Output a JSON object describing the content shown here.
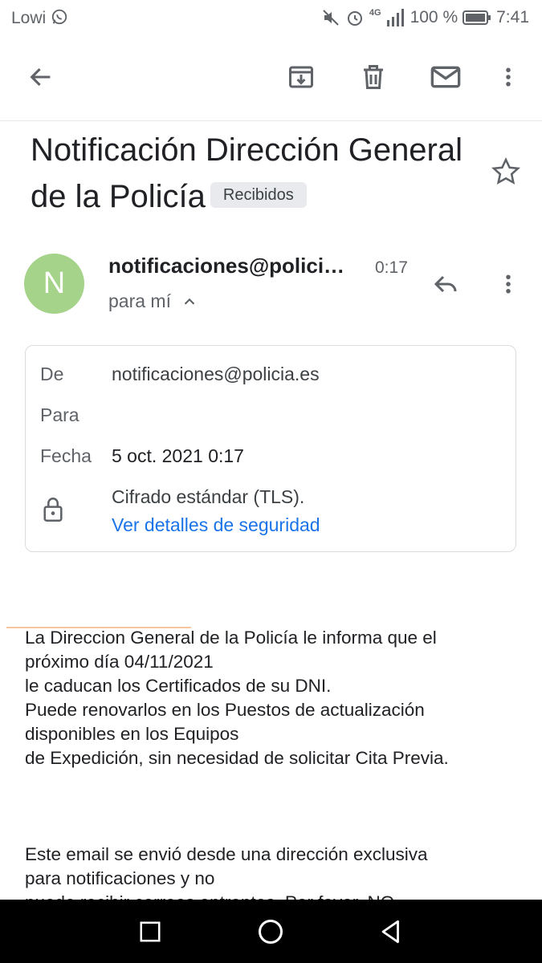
{
  "status_bar": {
    "carrier": "Lowi",
    "network": "4G",
    "battery": "100 %",
    "time": "7:41"
  },
  "toolbar": {
    "back": "back-arrow-icon",
    "archive": "archive-icon",
    "delete": "trash-icon",
    "mark_unread": "mail-icon",
    "more": "more-vertical-icon"
  },
  "email": {
    "subject": "Notificación Dirección General de la Policía",
    "label": "Recibidos",
    "sender_initial": "N",
    "sender_display": "notificaciones@polici…",
    "time": "0:17",
    "to_me": "para mí"
  },
  "details": {
    "from_label": "De",
    "from_value": "notificaciones@policia.es",
    "to_label": "Para",
    "date_label": "Fecha",
    "date_value": "5 oct. 2021 0:17",
    "encryption": "Cifrado estándar (TLS).",
    "security_link": "Ver detalles de seguridad"
  },
  "body": {
    "p1": [
      "La Direccion General de la Policía le informa que el",
      "próximo día 04/11/2021",
      "le caducan los Certificados de su DNI.",
      "Puede renovarlos en los Puestos de actualización",
      "disponibles en los Equipos",
      "de Expedición, sin necesidad de solicitar Cita Previa."
    ],
    "p2": [
      "Este email se envió desde una dirección exclusiva",
      "para notificaciones y no",
      "puede recibir correos entrantes. Por favor, NO"
    ]
  },
  "colors": {
    "avatar": "#a5d38a",
    "link": "#1a73e8",
    "nav_bar": "#000000"
  }
}
